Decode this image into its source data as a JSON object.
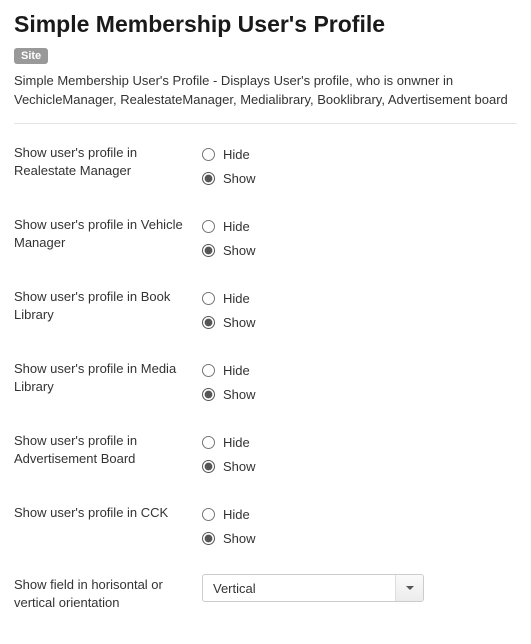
{
  "header": {
    "title": "Simple Membership User's Profile",
    "badge": "Site",
    "description": "Simple Membership User's Profile - Displays User's profile, who is onwner in VechicleManager, RealestateManager, Medialibrary, Booklibrary, Advertisement board"
  },
  "options": {
    "hide_label": "Hide",
    "show_label": "Show"
  },
  "fields": [
    {
      "label": "Show user's profile in Realestate Manager",
      "selected": "show"
    },
    {
      "label": "Show user's profile in Vehicle Manager",
      "selected": "show"
    },
    {
      "label": "Show user's profile in Book Library",
      "selected": "show"
    },
    {
      "label": "Show user's profile in Media Library",
      "selected": "show"
    },
    {
      "label": "Show user's profile in Advertisement Board",
      "selected": "show"
    },
    {
      "label": "Show user's profile in CCK",
      "selected": "show"
    }
  ],
  "orientation": {
    "label": "Show field in horisontal or vertical orientation",
    "value": "Vertical"
  }
}
